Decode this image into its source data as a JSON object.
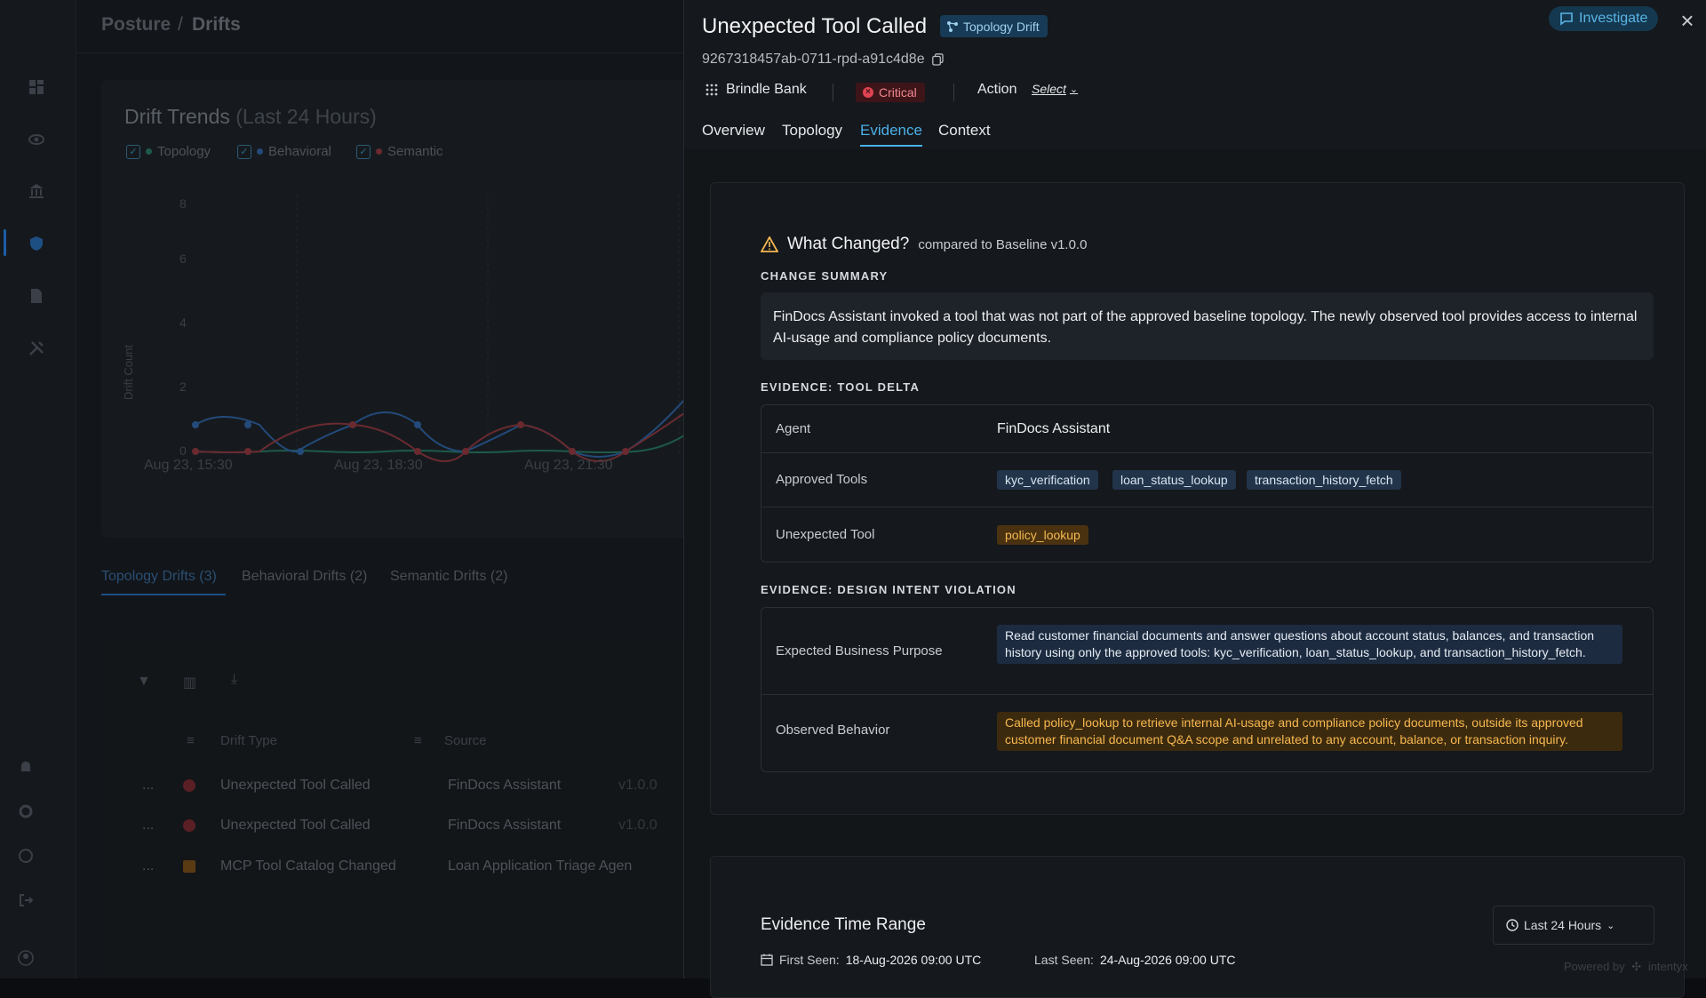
{
  "background": {
    "breadcrumb": [
      "Posture",
      "Drifts"
    ],
    "trend_card": {
      "title": "Drift Trends",
      "subtitle": "(Last 24 Hours)",
      "legend": [
        "Topology",
        "Behavioral",
        "Semantic"
      ],
      "ylabel": "Drift Count",
      "yticks": [
        "8",
        "6",
        "4",
        "2",
        "0"
      ],
      "xticks": [
        "Aug 23, 15:30",
        "Aug 23, 18:30",
        "Aug 23, 21:30"
      ]
    },
    "tabs": [
      "Topology Drifts (3)",
      "Behavioral Drifts (2)",
      "Semantic Drifts (2)"
    ],
    "table": {
      "headers": [
        "Drift Type",
        "Source"
      ],
      "rows": [
        {
          "type": "Unexpected Tool Called",
          "source": "FinDocs Assistant",
          "version": "v1.0.0"
        },
        {
          "type": "Unexpected Tool Called",
          "source": "FinDocs Assistant",
          "version": "v1.0.0"
        },
        {
          "type": "MCP Tool Catalog Changed",
          "source": "Loan Application Triage Agen",
          "version": ""
        }
      ],
      "row_menu": "..."
    }
  },
  "panel": {
    "title": "Unexpected Tool Called",
    "badge": "Topology Drift",
    "investigate_label": "Investigate",
    "close_label": "×",
    "id": "9267318457ab-0711-rpd-a91c4d8e",
    "org": "Brindle Bank",
    "severity": "Critical",
    "action_label": "Action",
    "action_select": "Select",
    "tabs": [
      "Overview",
      "Topology",
      "Evidence",
      "Context"
    ],
    "active_tab": "Evidence",
    "what_changed": {
      "title": "What Changed?",
      "compared": "compared to Baseline v1.0.0",
      "summary_label": "CHANGE SUMMARY",
      "summary": "FinDocs Assistant invoked a tool that was not part of the approved baseline topology. The newly observed tool provides access to internal AI-usage and compliance policy documents."
    },
    "tool_delta": {
      "label": "EVIDENCE: TOOL DELTA",
      "agent_label": "Agent",
      "agent": "FinDocs Assistant",
      "approved_label": "Approved Tools",
      "approved": [
        "kyc_verification",
        "loan_status_lookup",
        "transaction_history_fetch"
      ],
      "unexpected_label": "Unexpected Tool",
      "unexpected": "policy_lookup"
    },
    "intent": {
      "label": "EVIDENCE: DESIGN INTENT VIOLATION",
      "expected_label": "Expected Business Purpose",
      "expected": "Read customer financial documents and answer questions about account status, balances, and transaction history using only the approved tools: kyc_verification, loan_status_lookup, and transaction_history_fetch.",
      "observed_label": "Observed Behavior",
      "observed": "Called policy_lookup to retrieve internal AI-usage and compliance policy documents, outside its approved customer financial document Q&A scope and unrelated to any account, balance, or transaction inquiry."
    },
    "time_range": {
      "title": "Evidence Time Range",
      "range_select": "Last 24 Hours",
      "first_seen_label": "First Seen:",
      "first_seen": "18-Aug-2026 09:00 UTC",
      "last_seen_label": "Last Seen:",
      "last_seen": "24-Aug-2026 09:00 UTC"
    },
    "powered_by": "Powered by",
    "brand": "intentyx"
  },
  "colors": {
    "accent": "#4bb0ea",
    "critical": "#e04351",
    "warning": "#f6b850"
  }
}
